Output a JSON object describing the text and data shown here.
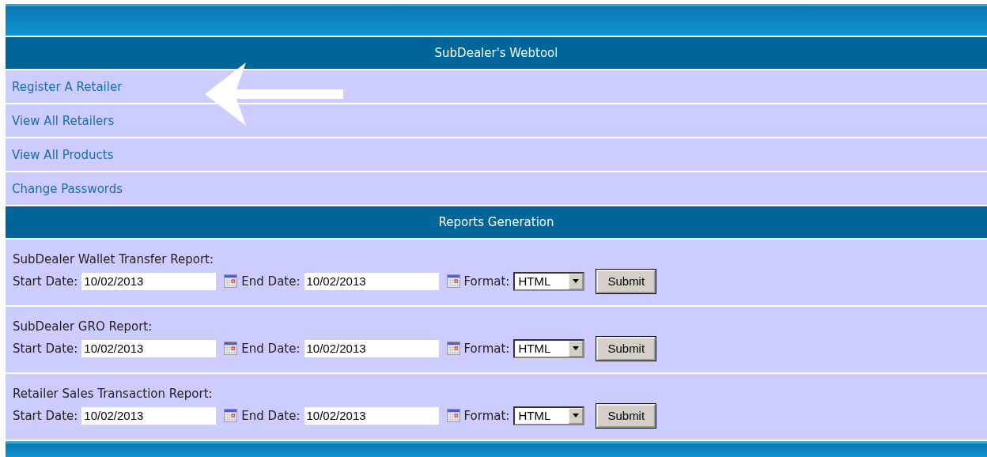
{
  "title": "SubDealer's Webtool",
  "menu": [
    {
      "label": "Register A Retailer",
      "pointed": true
    },
    {
      "label": "View All Retailers",
      "pointed": false
    },
    {
      "label": "View All Products",
      "pointed": false
    },
    {
      "label": "Change Passwords",
      "pointed": false
    }
  ],
  "reports_header": "Reports Generation",
  "reports": [
    {
      "title": "SubDealer Wallet Transfer Report:",
      "start_label": "Start Date:",
      "start_value": "10/02/2013",
      "end_label": "End Date:",
      "end_value": "10/02/2013",
      "format_label": "Format:",
      "format_value": "HTML",
      "submit": "Submit"
    },
    {
      "title": "SubDealer GRO Report:",
      "start_label": "Start Date:",
      "start_value": "10/02/2013",
      "end_label": "End Date:",
      "end_value": "10/02/2013",
      "format_label": "Format:",
      "format_value": "HTML",
      "submit": "Submit"
    },
    {
      "title": "Retailer Sales Transaction Report:",
      "start_label": "Start Date:",
      "start_value": "10/02/2013",
      "end_label": "End Date:",
      "end_value": "10/02/2013",
      "format_label": "Format:",
      "format_value": "HTML",
      "submit": "Submit"
    }
  ]
}
